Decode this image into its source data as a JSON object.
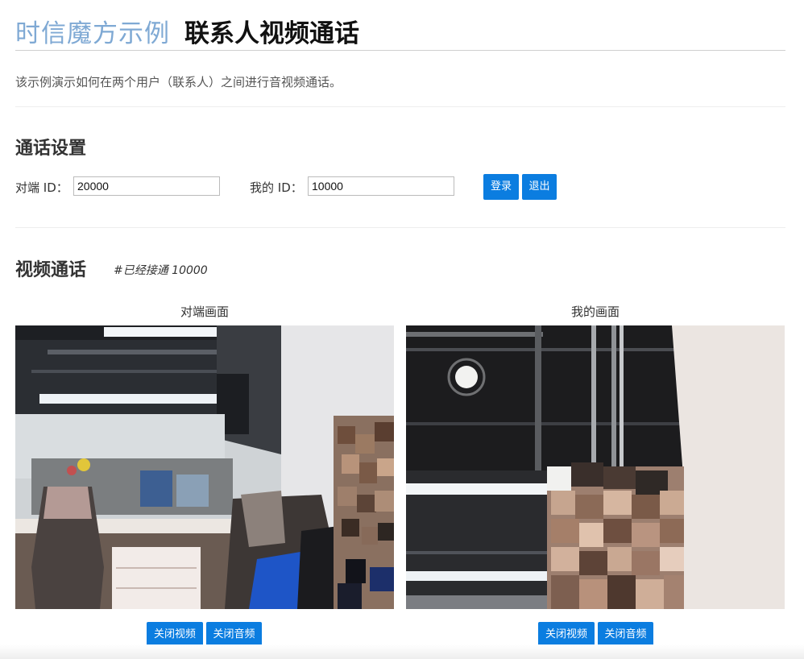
{
  "header": {
    "brand": "时信魔方示例",
    "title": "联系人视频通话"
  },
  "description": "该示例演示如何在两个用户（联系人）之间进行音视频通话。",
  "settings": {
    "heading": "通话设置",
    "peer_label": "对端 ID：",
    "peer_value": "20000",
    "my_label": "我的 ID：",
    "my_value": "10000",
    "login_label": "登录",
    "logout_label": "退出"
  },
  "call": {
    "heading": "视频通话",
    "status": "#已经接通 10000",
    "remote": {
      "caption": "对端画面",
      "video_off_label": "关闭视频",
      "audio_off_label": "关闭音频"
    },
    "local": {
      "caption": "我的画面",
      "video_off_label": "关闭视频",
      "audio_off_label": "关闭音频"
    }
  },
  "colors": {
    "brand": "#7fa9d4",
    "button": "#0b7de0"
  }
}
